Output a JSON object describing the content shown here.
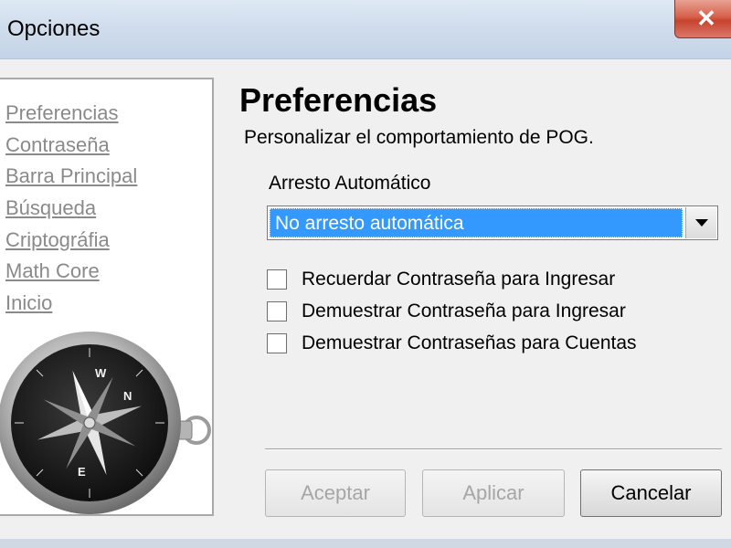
{
  "window": {
    "title": "Opciones",
    "close_glyph": "✕"
  },
  "sidebar": {
    "items": [
      {
        "label": "Preferencias"
      },
      {
        "label": "Contraseña"
      },
      {
        "label": "Barra Principal"
      },
      {
        "label": "Búsqueda"
      },
      {
        "label": "Criptográfia"
      },
      {
        "label": "Math Core"
      },
      {
        "label": "Inicio"
      }
    ],
    "image": {
      "name": "compass-image",
      "letters": [
        "W",
        "N",
        "E"
      ]
    }
  },
  "main": {
    "heading": "Preferencias",
    "subtitle": "Personalizar el comportamiento de POG.",
    "autolock": {
      "label": "Arresto Automático",
      "selected": "No arresto automática"
    },
    "checkboxes": [
      {
        "label": "Recuerdar Contraseña para Ingresar",
        "checked": false
      },
      {
        "label": "Demuestrar Contraseña para Ingresar",
        "checked": false
      },
      {
        "label": "Demuestrar Contraseñas para Cuentas",
        "checked": false
      }
    ]
  },
  "buttons": {
    "accept": {
      "label": "Aceptar",
      "enabled": false
    },
    "apply": {
      "label": "Aplicar",
      "enabled": false
    },
    "cancel": {
      "label": "Cancelar",
      "enabled": true
    }
  },
  "colors": {
    "selection": "#3399ff",
    "link": "#8a8a8a",
    "close_button": "#c7432e"
  }
}
